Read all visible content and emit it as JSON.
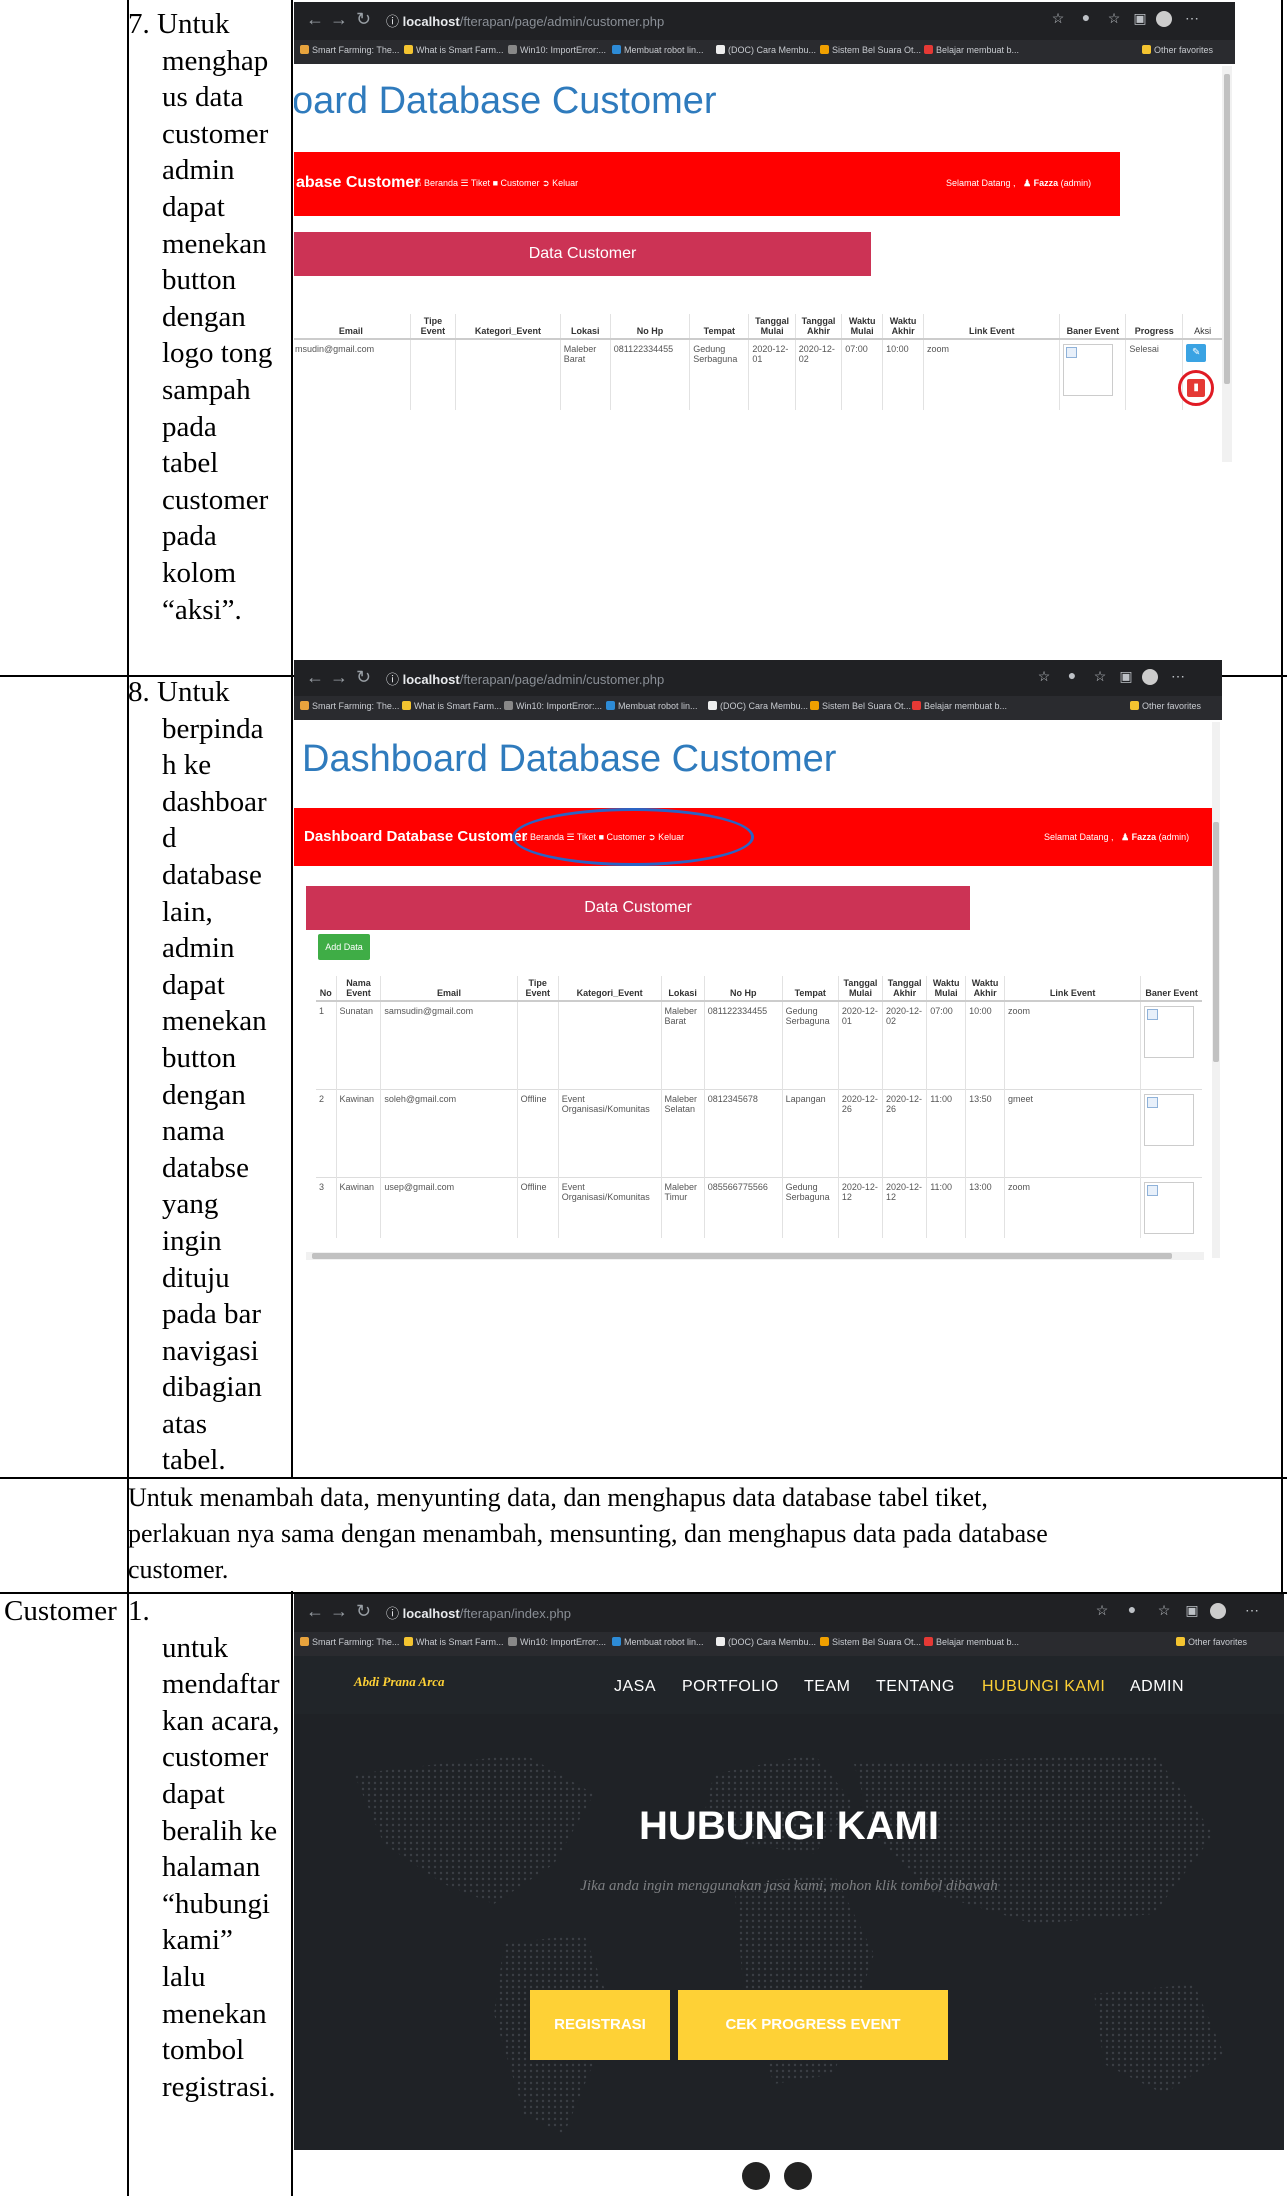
{
  "rows": {
    "step7": {
      "text": [
        "7. Untuk",
        "menghap",
        "us data",
        "customer",
        "admin",
        "dapat",
        "menekan",
        "button",
        "dengan",
        "logo tong",
        "sampah",
        "pada",
        "tabel",
        "customer",
        "pada",
        "kolom",
        "“aksi”."
      ]
    },
    "step8": {
      "text": [
        "8.  Untuk",
        "berpinda",
        "h ke",
        "dashboar",
        "d",
        "database",
        "lain,",
        "admin",
        "dapat",
        "menekan",
        "button",
        "dengan",
        "nama",
        "databse",
        "yang",
        "ingin",
        "dituju",
        "pada bar",
        "navigasi",
        "dibagian",
        "atas",
        "tabel."
      ]
    },
    "note": {
      "lines": [
        "Untuk menambah data, menyunting data, dan menghapus data database tabel tiket,",
        "perlakuan nya sama dengan menambah, mensunting, dan menghapus data pada database",
        "customer."
      ]
    },
    "customer": {
      "role": "Customer",
      "text": [
        "1.",
        "untuk",
        "mendaftar",
        "kan acara,",
        "customer",
        "dapat",
        "beralih ke",
        "halaman",
        "“hubungi",
        "kami”",
        "lalu",
        "menekan",
        "tombol",
        "registrasi."
      ]
    }
  },
  "browser": {
    "url_host": "localhost",
    "url_admin": "/fterapan/page/admin/customer.php",
    "url_index": "/fterapan/index.php",
    "bookmarks": [
      "Smart Farming: The...",
      "What is Smart Farm...",
      "Win10: ImportError:...",
      "Membuat robot lin...",
      "(DOC) Cara Membu...",
      "Sistem Bel Suara Ot...",
      "Belajar membuat b..."
    ],
    "other_favorites": "Other favorites"
  },
  "admin": {
    "page_title": "Dashboard Database Customer",
    "page_title_cropped": "oard Database Customer",
    "bar_title": "Dashboard Database Customer",
    "bar_title_cropped": "abase Customer",
    "nav": [
      "Beranda",
      "Tiket",
      "Customer",
      "Keluar"
    ],
    "welcome": "Selamat Datang ,",
    "user": "Fazza",
    "role": "(admin)",
    "section": "Data Customer",
    "add_button": "Add Data",
    "table1": {
      "headers": [
        "Email",
        "Tipe Event",
        "Kategori_Event",
        "Lokasi",
        "No Hp",
        "Tempat",
        "Tanggal Mulai",
        "Tanggal Akhir",
        "Waktu Mulai",
        "Waktu Akhir",
        "Link Event",
        "Baner Event",
        "Progress",
        "Aksi"
      ],
      "row": [
        "msudin@gmail.com",
        "",
        "",
        "Maleber Barat",
        "081122334455",
        "Gedung Serbaguna",
        "2020-12-01",
        "2020-12-02",
        "07:00",
        "10:00",
        "zoom",
        "",
        "Selesai",
        ""
      ]
    },
    "table2": {
      "headers": [
        "No",
        "Nama Event",
        "Email",
        "Tipe Event",
        "Kategori_Event",
        "Lokasi",
        "No Hp",
        "Tempat",
        "Tanggal Mulai",
        "Tanggal Akhir",
        "Waktu Mulai",
        "Waktu Akhir",
        "Link Event",
        "Baner Event"
      ],
      "rows": [
        [
          "1",
          "Sunatan",
          "samsudin@gmail.com",
          "",
          "",
          "Maleber Barat",
          "081122334455",
          "Gedung Serbaguna",
          "2020-12-01",
          "2020-12-02",
          "07:00",
          "10:00",
          "zoom",
          ""
        ],
        [
          "2",
          "Kawinan",
          "soleh@gmail.com",
          "Offline",
          "Event Organisasi/Komunitas",
          "Maleber Selatan",
          "0812345678",
          "Lapangan",
          "2020-12-26",
          "2020-12-26",
          "11:00",
          "13:50",
          "gmeet",
          ""
        ],
        [
          "3",
          "Kawinan",
          "usep@gmail.com",
          "Offline",
          "Event Organisasi/Komunitas",
          "Maleber Timur",
          "085566775566",
          "Gedung Serbaguna",
          "2020-12-12",
          "2020-12-12",
          "11:00",
          "13:00",
          "zoom",
          ""
        ]
      ]
    }
  },
  "landing": {
    "brand": "Abdi Prana Arca",
    "nav": [
      "JASA",
      "PORTFOLIO",
      "TEAM",
      "TENTANG",
      "HUBUNGI KAMI",
      "ADMIN"
    ],
    "title": "HUBUNGI KAMI",
    "subtitle": "Jika anda ingin menggunakan jasa kami, mohon klik tombol dibawah",
    "btn_register": "REGISTRASI",
    "btn_progress": "CEK PROGRESS EVENT"
  },
  "colors": {
    "red_bar": "#ff0000",
    "data_bar": "#cc3355",
    "title_blue": "#2f7bbd",
    "yellow": "#fed136",
    "highlight_red": "#e01b24",
    "highlight_blue": "#2a64c5"
  }
}
